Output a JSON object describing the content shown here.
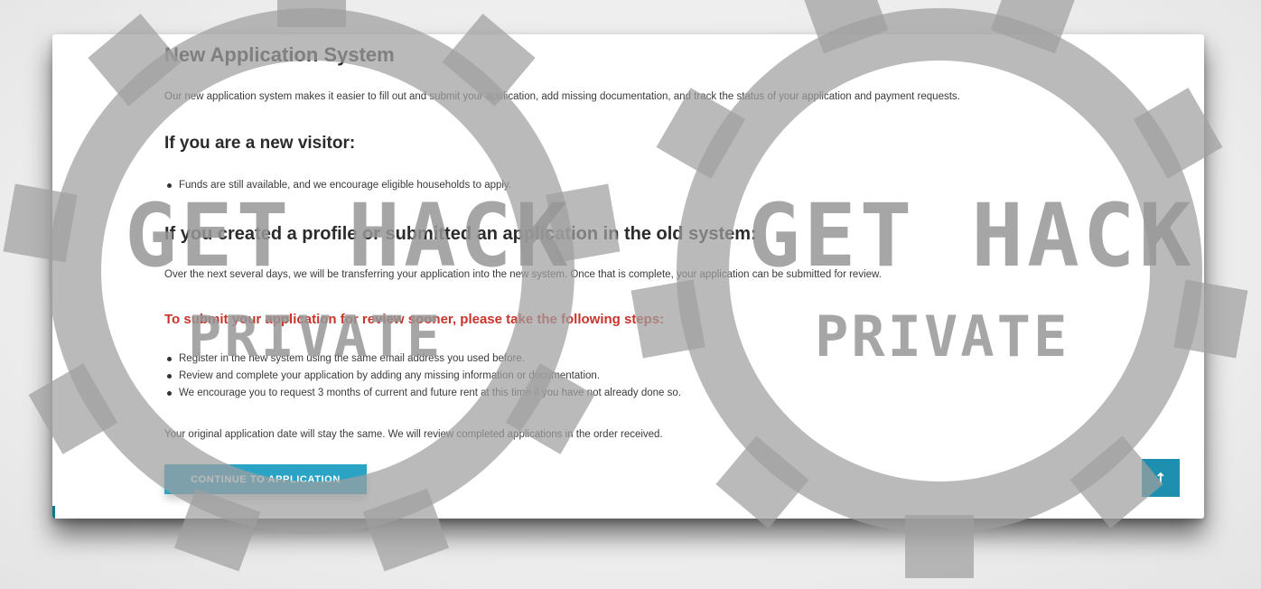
{
  "page": {
    "title": "New Application System",
    "intro": "Our new application system makes it easier to fill out and submit your application, add missing documentation, and track the status of your application and payment requests."
  },
  "new_visitor": {
    "heading": "If you are a new visitor:",
    "items": [
      "Funds are still available, and we encourage eligible households to apply."
    ]
  },
  "old_system": {
    "heading": "If you created a profile or submitted an application in the old system:",
    "paragraph": "Over the next several days, we will be transferring your application into the new system. Once that is complete, your application can be submitted for review.",
    "steps_heading": "To submit your application for review sooner, please take the following steps:",
    "steps": [
      "Register in the new system using the same email address you used before.",
      "Review and complete your application by adding any missing information or documentation.",
      "We encourage you to request 3 months of current and future rent at this time if you have not already done so."
    ],
    "closing": "Your original application date will stay the same. We will review completed applications in the order received."
  },
  "actions": {
    "continue_label": "CONTINUE TO APPLICATION",
    "back_to_top_icon": "arrow-up-icon",
    "back_to_top_glyph": "↑"
  },
  "watermark": {
    "line1": "GET HACK",
    "line2": "PRIVATE"
  },
  "colors": {
    "accent": "#2aa3c4",
    "back_to_top": "#1e8fae",
    "warning_text": "#c8342b",
    "card_edge": "#0f7a86"
  }
}
